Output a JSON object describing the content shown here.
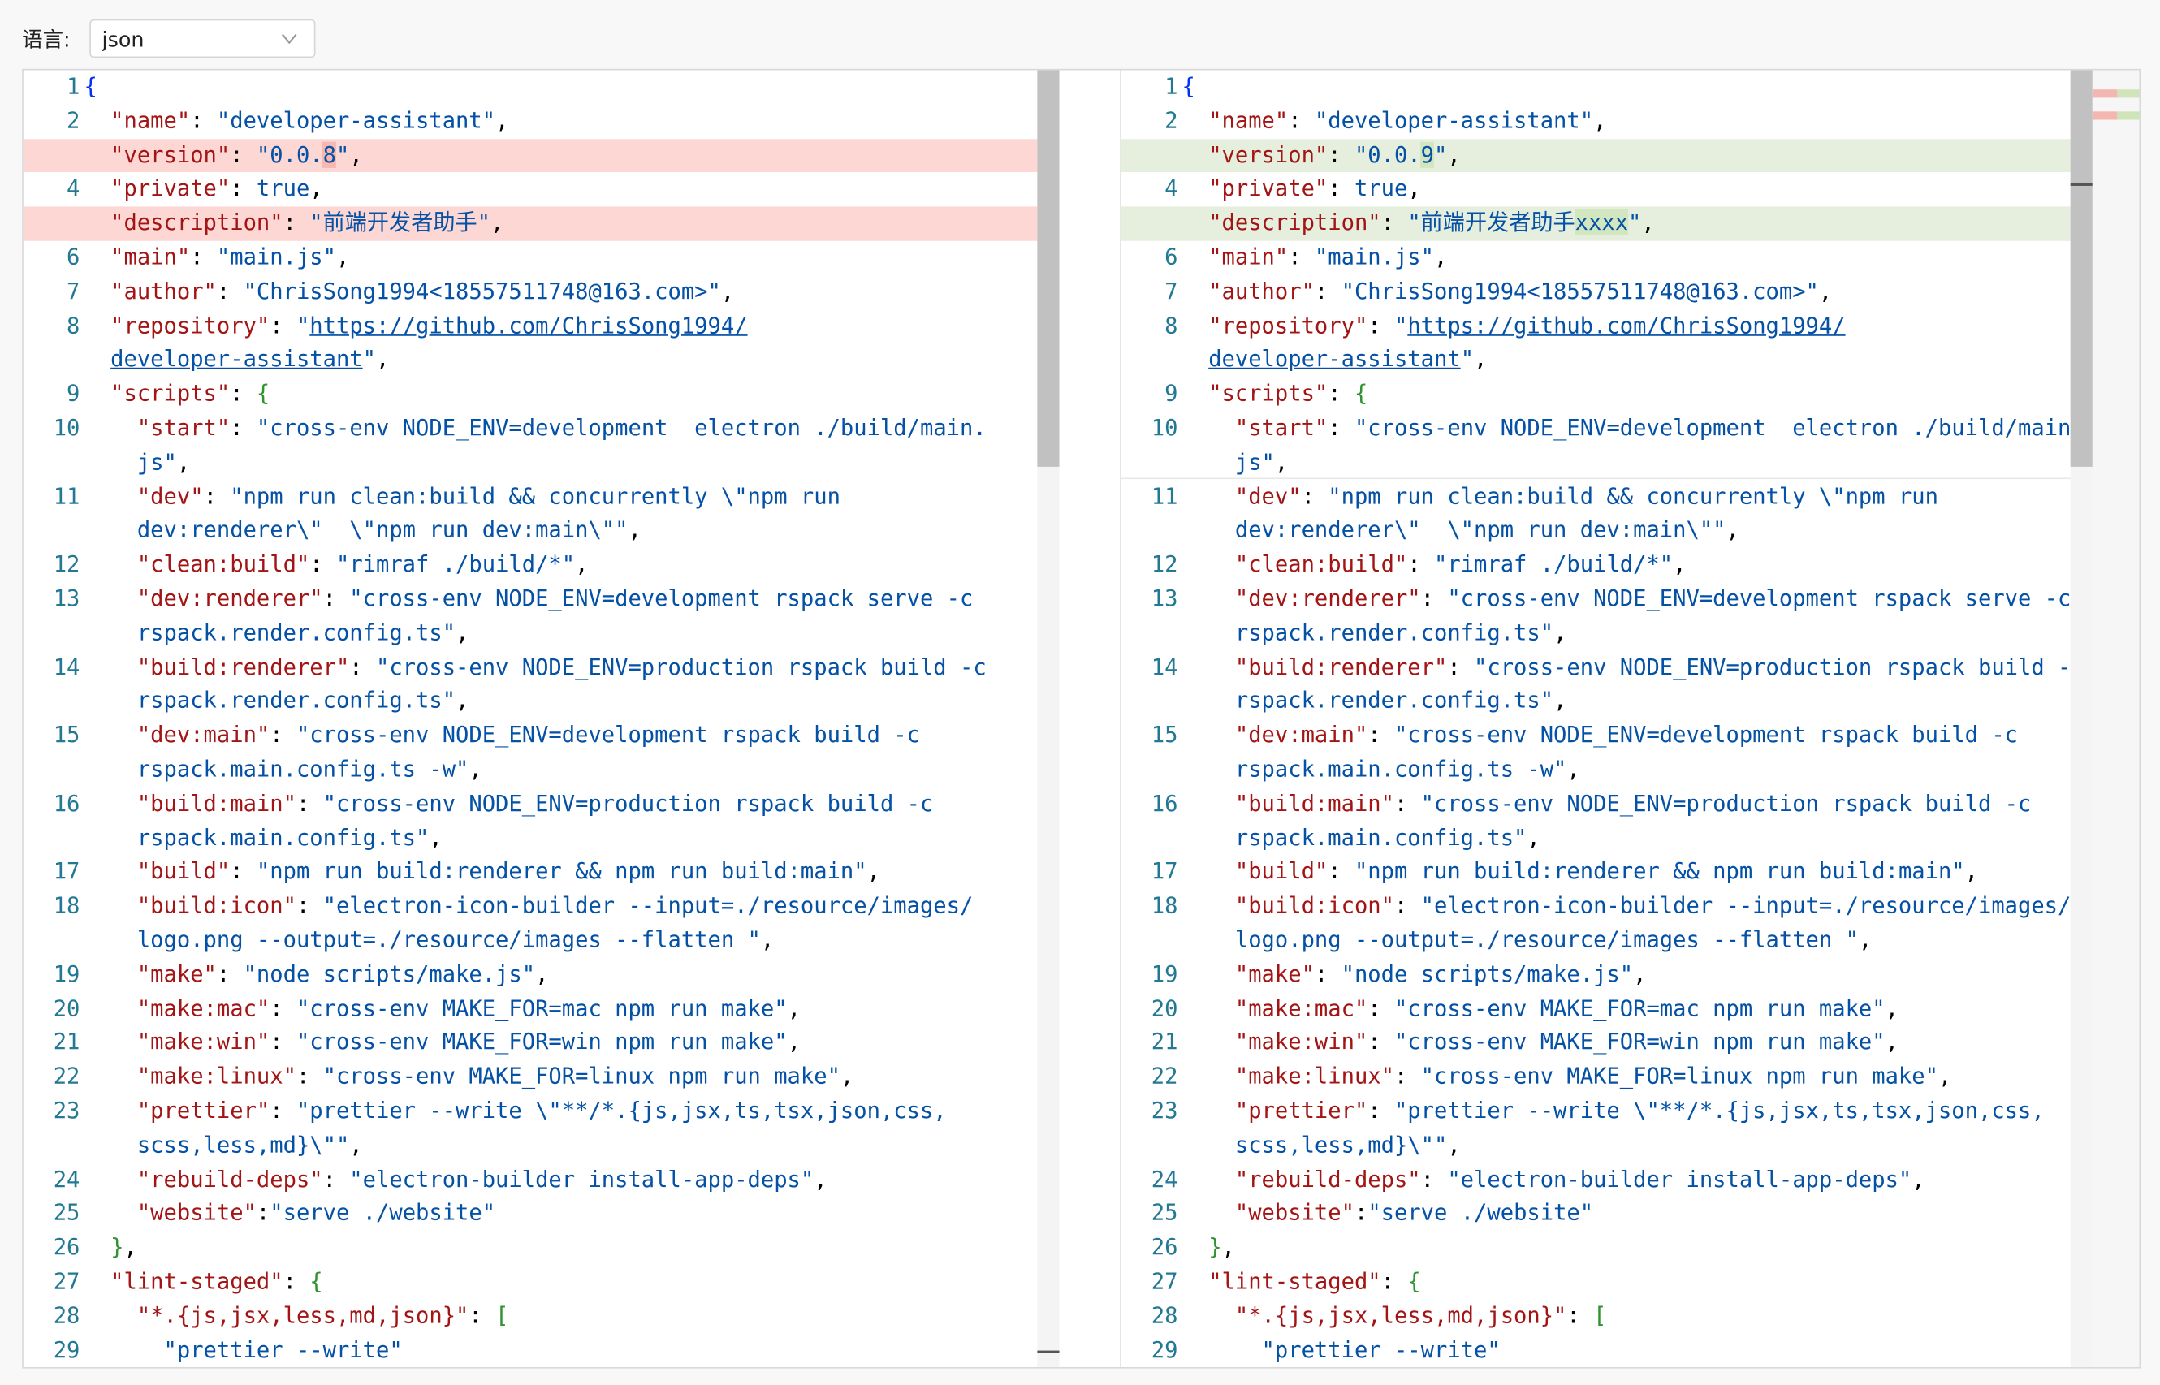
{
  "toolbar": {
    "language_label": "语言:",
    "language_value": "json"
  },
  "overview_colors": {
    "deleted": "#f4b6b0",
    "inserted": "#cfe4b8"
  },
  "left_lines": [
    {
      "n": "1",
      "segs": [
        [
          "b",
          "{"
        ]
      ]
    },
    {
      "n": "2",
      "segs": [
        [
          "k",
          "  \"name\""
        ],
        [
          "p",
          ": "
        ],
        [
          "s",
          "\"developer-assistant\""
        ],
        [
          "p",
          ","
        ]
      ]
    },
    {
      "n": "3",
      "segs": [
        [
          "k",
          "  \"version\""
        ],
        [
          "p",
          ": "
        ],
        [
          "s",
          "\"0.0."
        ],
        [
          "s",
          "8",
          "ch-del"
        ],
        [
          "s",
          "\""
        ],
        [
          "p",
          ","
        ]
      ],
      "hl": "del"
    },
    {
      "n": "4",
      "segs": [
        [
          "k",
          "  \"private\""
        ],
        [
          "p",
          ": "
        ],
        [
          "s",
          "true"
        ],
        [
          "p",
          ","
        ]
      ]
    },
    {
      "n": "5",
      "segs": [
        [
          "k",
          "  \"description\""
        ],
        [
          "p",
          ": "
        ],
        [
          "s",
          "\"前端开发者助手\""
        ],
        [
          "p",
          ","
        ]
      ],
      "hl": "del"
    },
    {
      "n": "6",
      "segs": [
        [
          "k",
          "  \"main\""
        ],
        [
          "p",
          ": "
        ],
        [
          "s",
          "\"main.js\""
        ],
        [
          "p",
          ","
        ]
      ]
    },
    {
      "n": "7",
      "segs": [
        [
          "k",
          "  \"author\""
        ],
        [
          "p",
          ": "
        ],
        [
          "s",
          "\"ChrisSong1994<18557511748@163.com>\""
        ],
        [
          "p",
          ","
        ]
      ]
    },
    {
      "n": "8",
      "segs": [
        [
          "k",
          "  \"repository\""
        ],
        [
          "p",
          ": "
        ],
        [
          "s",
          "\""
        ],
        [
          "s",
          "https://github.com/ChrisSong1994/",
          "u"
        ]
      ]
    },
    {
      "n": "",
      "segs": [
        [
          "s",
          "  "
        ],
        [
          "s",
          "developer-assistant",
          "u"
        ],
        [
          "s",
          "\""
        ],
        [
          "p",
          ","
        ]
      ]
    },
    {
      "n": "9",
      "segs": [
        [
          "k",
          "  \"scripts\""
        ],
        [
          "p",
          ": "
        ],
        [
          "b2",
          "{"
        ]
      ]
    },
    {
      "n": "10",
      "segs": [
        [
          "k",
          "    \"start\""
        ],
        [
          "p",
          ": "
        ],
        [
          "s",
          "\"cross-env NODE_ENV=development  electron ./build/main."
        ]
      ]
    },
    {
      "n": "",
      "segs": [
        [
          "s",
          "    js\""
        ],
        [
          "p",
          ","
        ]
      ]
    },
    {
      "n": "11",
      "segs": [
        [
          "k",
          "    \"dev\""
        ],
        [
          "p",
          ": "
        ],
        [
          "s",
          "\"npm run clean:build && concurrently \\\"npm run"
        ]
      ]
    },
    {
      "n": "",
      "segs": [
        [
          "s",
          "    dev:renderer\\\"  \\\"npm run dev:main\\\"\""
        ],
        [
          "p",
          ","
        ]
      ]
    },
    {
      "n": "12",
      "segs": [
        [
          "k",
          "    \"clean:build\""
        ],
        [
          "p",
          ": "
        ],
        [
          "s",
          "\"rimraf ./build/*\""
        ],
        [
          "p",
          ","
        ]
      ]
    },
    {
      "n": "13",
      "segs": [
        [
          "k",
          "    \"dev:renderer\""
        ],
        [
          "p",
          ": "
        ],
        [
          "s",
          "\"cross-env NODE_ENV=development rspack serve -c"
        ]
      ]
    },
    {
      "n": "",
      "segs": [
        [
          "s",
          "    rspack.render.config.ts\""
        ],
        [
          "p",
          ","
        ]
      ]
    },
    {
      "n": "14",
      "segs": [
        [
          "k",
          "    \"build:renderer\""
        ],
        [
          "p",
          ": "
        ],
        [
          "s",
          "\"cross-env NODE_ENV=production rspack build -c"
        ]
      ]
    },
    {
      "n": "",
      "segs": [
        [
          "s",
          "    rspack.render.config.ts\""
        ],
        [
          "p",
          ","
        ]
      ]
    },
    {
      "n": "15",
      "segs": [
        [
          "k",
          "    \"dev:main\""
        ],
        [
          "p",
          ": "
        ],
        [
          "s",
          "\"cross-env NODE_ENV=development rspack build -c"
        ]
      ]
    },
    {
      "n": "",
      "segs": [
        [
          "s",
          "    rspack.main.config.ts -w\""
        ],
        [
          "p",
          ","
        ]
      ]
    },
    {
      "n": "16",
      "segs": [
        [
          "k",
          "    \"build:main\""
        ],
        [
          "p",
          ": "
        ],
        [
          "s",
          "\"cross-env NODE_ENV=production rspack build -c"
        ]
      ]
    },
    {
      "n": "",
      "segs": [
        [
          "s",
          "    rspack.main.config.ts\""
        ],
        [
          "p",
          ","
        ]
      ]
    },
    {
      "n": "17",
      "segs": [
        [
          "k",
          "    \"build\""
        ],
        [
          "p",
          ": "
        ],
        [
          "s",
          "\"npm run build:renderer && npm run build:main\""
        ],
        [
          "p",
          ","
        ]
      ]
    },
    {
      "n": "18",
      "segs": [
        [
          "k",
          "    \"build:icon\""
        ],
        [
          "p",
          ": "
        ],
        [
          "s",
          "\"electron-icon-builder --input=./resource/images/"
        ]
      ]
    },
    {
      "n": "",
      "segs": [
        [
          "s",
          "    logo.png --output=./resource/images --flatten \""
        ],
        [
          "p",
          ","
        ]
      ]
    },
    {
      "n": "19",
      "segs": [
        [
          "k",
          "    \"make\""
        ],
        [
          "p",
          ": "
        ],
        [
          "s",
          "\"node scripts/make.js\""
        ],
        [
          "p",
          ","
        ]
      ]
    },
    {
      "n": "20",
      "segs": [
        [
          "k",
          "    \"make:mac\""
        ],
        [
          "p",
          ": "
        ],
        [
          "s",
          "\"cross-env MAKE_FOR=mac npm run make\""
        ],
        [
          "p",
          ","
        ]
      ]
    },
    {
      "n": "21",
      "segs": [
        [
          "k",
          "    \"make:win\""
        ],
        [
          "p",
          ": "
        ],
        [
          "s",
          "\"cross-env MAKE_FOR=win npm run make\""
        ],
        [
          "p",
          ","
        ]
      ]
    },
    {
      "n": "22",
      "segs": [
        [
          "k",
          "    \"make:linux\""
        ],
        [
          "p",
          ": "
        ],
        [
          "s",
          "\"cross-env MAKE_FOR=linux npm run make\""
        ],
        [
          "p",
          ","
        ]
      ]
    },
    {
      "n": "23",
      "segs": [
        [
          "k",
          "    \"prettier\""
        ],
        [
          "p",
          ": "
        ],
        [
          "s",
          "\"prettier --write \\\"**/*.{js,jsx,ts,tsx,json,css,"
        ]
      ]
    },
    {
      "n": "",
      "segs": [
        [
          "s",
          "    scss,less,md}\\\"\""
        ],
        [
          "p",
          ","
        ]
      ]
    },
    {
      "n": "24",
      "segs": [
        [
          "k",
          "    \"rebuild-deps\""
        ],
        [
          "p",
          ": "
        ],
        [
          "s",
          "\"electron-builder install-app-deps\""
        ],
        [
          "p",
          ","
        ]
      ]
    },
    {
      "n": "25",
      "segs": [
        [
          "k",
          "    \"website\""
        ],
        [
          "p",
          ":"
        ],
        [
          "s",
          "\"serve ./website\""
        ]
      ]
    },
    {
      "n": "26",
      "segs": [
        [
          "b2",
          "  }"
        ],
        [
          "p",
          ","
        ]
      ]
    },
    {
      "n": "27",
      "segs": [
        [
          "k",
          "  \"lint-staged\""
        ],
        [
          "p",
          ": "
        ],
        [
          "b2",
          "{"
        ]
      ]
    },
    {
      "n": "28",
      "segs": [
        [
          "k",
          "    \"*.{js,jsx,less,md,json}\""
        ],
        [
          "p",
          ": "
        ],
        [
          "b2",
          "["
        ]
      ]
    },
    {
      "n": "29",
      "segs": [
        [
          "s",
          "      \"prettier --write\""
        ]
      ]
    }
  ],
  "right_lines": [
    {
      "n": "1",
      "segs": [
        [
          "b",
          "{"
        ]
      ]
    },
    {
      "n": "2",
      "segs": [
        [
          "k",
          "  \"name\""
        ],
        [
          "p",
          ": "
        ],
        [
          "s",
          "\"developer-assistant\""
        ],
        [
          "p",
          ","
        ]
      ]
    },
    {
      "n": "3",
      "segs": [
        [
          "k",
          "  \"version\""
        ],
        [
          "p",
          ": "
        ],
        [
          "s",
          "\"0.0."
        ],
        [
          "s",
          "9",
          "ch-add"
        ],
        [
          "s",
          "\""
        ],
        [
          "p",
          ","
        ]
      ],
      "hl": "add"
    },
    {
      "n": "4",
      "segs": [
        [
          "k",
          "  \"private\""
        ],
        [
          "p",
          ": "
        ],
        [
          "s",
          "true"
        ],
        [
          "p",
          ","
        ]
      ]
    },
    {
      "n": "5",
      "segs": [
        [
          "k",
          "  \"description\""
        ],
        [
          "p",
          ": "
        ],
        [
          "s",
          "\"前端开发者助手"
        ],
        [
          "s",
          "xxxx",
          "ch-add"
        ],
        [
          "s",
          "\""
        ],
        [
          "p",
          ","
        ]
      ],
      "hl": "add"
    },
    {
      "n": "6",
      "segs": [
        [
          "k",
          "  \"main\""
        ],
        [
          "p",
          ": "
        ],
        [
          "s",
          "\"main.js\""
        ],
        [
          "p",
          ","
        ]
      ]
    },
    {
      "n": "7",
      "segs": [
        [
          "k",
          "  \"author\""
        ],
        [
          "p",
          ": "
        ],
        [
          "s",
          "\"ChrisSong1994<18557511748@163.com>\""
        ],
        [
          "p",
          ","
        ]
      ]
    },
    {
      "n": "8",
      "segs": [
        [
          "k",
          "  \"repository\""
        ],
        [
          "p",
          ": "
        ],
        [
          "s",
          "\""
        ],
        [
          "s",
          "https://github.com/ChrisSong1994/",
          "u"
        ]
      ]
    },
    {
      "n": "",
      "segs": [
        [
          "s",
          "  "
        ],
        [
          "s",
          "developer-assistant",
          "u"
        ],
        [
          "s",
          "\""
        ],
        [
          "p",
          ","
        ]
      ]
    },
    {
      "n": "9",
      "segs": [
        [
          "k",
          "  \"scripts\""
        ],
        [
          "p",
          ": "
        ],
        [
          "b2",
          "{"
        ]
      ]
    },
    {
      "n": "10",
      "segs": [
        [
          "k",
          "    \"start\""
        ],
        [
          "p",
          ": "
        ],
        [
          "s",
          "\"cross-env NODE_ENV=development  electron ./build/main."
        ]
      ]
    },
    {
      "n": "",
      "segs": [
        [
          "s",
          "    js\""
        ],
        [
          "p",
          ","
        ]
      ]
    },
    {
      "n": "11",
      "segs": [
        [
          "k",
          "    \"dev\""
        ],
        [
          "p",
          ": "
        ],
        [
          "s",
          "\"npm run clean:build && concurrently \\\"npm run"
        ]
      ]
    },
    {
      "n": "",
      "segs": [
        [
          "s",
          "    dev:renderer\\\"  \\\"npm run dev:main\\\"\""
        ],
        [
          "p",
          ","
        ]
      ]
    },
    {
      "n": "12",
      "segs": [
        [
          "k",
          "    \"clean:build\""
        ],
        [
          "p",
          ": "
        ],
        [
          "s",
          "\"rimraf ./build/*\""
        ],
        [
          "p",
          ","
        ]
      ]
    },
    {
      "n": "13",
      "segs": [
        [
          "k",
          "    \"dev:renderer\""
        ],
        [
          "p",
          ": "
        ],
        [
          "s",
          "\"cross-env NODE_ENV=development rspack serve -c"
        ]
      ]
    },
    {
      "n": "",
      "segs": [
        [
          "s",
          "    rspack.render.config.ts\""
        ],
        [
          "p",
          ","
        ]
      ]
    },
    {
      "n": "14",
      "segs": [
        [
          "k",
          "    \"build:renderer\""
        ],
        [
          "p",
          ": "
        ],
        [
          "s",
          "\"cross-env NODE_ENV=production rspack build -c"
        ]
      ]
    },
    {
      "n": "",
      "segs": [
        [
          "s",
          "    rspack.render.config.ts\""
        ],
        [
          "p",
          ","
        ]
      ]
    },
    {
      "n": "15",
      "segs": [
        [
          "k",
          "    \"dev:main\""
        ],
        [
          "p",
          ": "
        ],
        [
          "s",
          "\"cross-env NODE_ENV=development rspack build -c"
        ]
      ]
    },
    {
      "n": "",
      "segs": [
        [
          "s",
          "    rspack.main.config.ts -w\""
        ],
        [
          "p",
          ","
        ]
      ]
    },
    {
      "n": "16",
      "segs": [
        [
          "k",
          "    \"build:main\""
        ],
        [
          "p",
          ": "
        ],
        [
          "s",
          "\"cross-env NODE_ENV=production rspack build -c"
        ]
      ]
    },
    {
      "n": "",
      "segs": [
        [
          "s",
          "    rspack.main.config.ts\""
        ],
        [
          "p",
          ","
        ]
      ]
    },
    {
      "n": "17",
      "segs": [
        [
          "k",
          "    \"build\""
        ],
        [
          "p",
          ": "
        ],
        [
          "s",
          "\"npm run build:renderer && npm run build:main\""
        ],
        [
          "p",
          ","
        ]
      ]
    },
    {
      "n": "18",
      "segs": [
        [
          "k",
          "    \"build:icon\""
        ],
        [
          "p",
          ": "
        ],
        [
          "s",
          "\"electron-icon-builder --input=./resource/images/"
        ]
      ]
    },
    {
      "n": "",
      "segs": [
        [
          "s",
          "    logo.png --output=./resource/images --flatten \""
        ],
        [
          "p",
          ","
        ]
      ]
    },
    {
      "n": "19",
      "segs": [
        [
          "k",
          "    \"make\""
        ],
        [
          "p",
          ": "
        ],
        [
          "s",
          "\"node scripts/make.js\""
        ],
        [
          "p",
          ","
        ]
      ]
    },
    {
      "n": "20",
      "segs": [
        [
          "k",
          "    \"make:mac\""
        ],
        [
          "p",
          ": "
        ],
        [
          "s",
          "\"cross-env MAKE_FOR=mac npm run make\""
        ],
        [
          "p",
          ","
        ]
      ]
    },
    {
      "n": "21",
      "segs": [
        [
          "k",
          "    \"make:win\""
        ],
        [
          "p",
          ": "
        ],
        [
          "s",
          "\"cross-env MAKE_FOR=win npm run make\""
        ],
        [
          "p",
          ","
        ]
      ]
    },
    {
      "n": "22",
      "segs": [
        [
          "k",
          "    \"make:linux\""
        ],
        [
          "p",
          ": "
        ],
        [
          "s",
          "\"cross-env MAKE_FOR=linux npm run make\""
        ],
        [
          "p",
          ","
        ]
      ]
    },
    {
      "n": "23",
      "segs": [
        [
          "k",
          "    \"prettier\""
        ],
        [
          "p",
          ": "
        ],
        [
          "s",
          "\"prettier --write \\\"**/*.{js,jsx,ts,tsx,json,css,"
        ]
      ]
    },
    {
      "n": "",
      "segs": [
        [
          "s",
          "    scss,less,md}\\\"\""
        ],
        [
          "p",
          ","
        ]
      ]
    },
    {
      "n": "24",
      "segs": [
        [
          "k",
          "    \"rebuild-deps\""
        ],
        [
          "p",
          ": "
        ],
        [
          "s",
          "\"electron-builder install-app-deps\""
        ],
        [
          "p",
          ","
        ]
      ]
    },
    {
      "n": "25",
      "segs": [
        [
          "k",
          "    \"website\""
        ],
        [
          "p",
          ":"
        ],
        [
          "s",
          "\"serve ./website\""
        ]
      ]
    },
    {
      "n": "26",
      "segs": [
        [
          "b2",
          "  }"
        ],
        [
          "p",
          ","
        ]
      ]
    },
    {
      "n": "27",
      "segs": [
        [
          "k",
          "  \"lint-staged\""
        ],
        [
          "p",
          ": "
        ],
        [
          "b2",
          "{"
        ]
      ]
    },
    {
      "n": "28",
      "segs": [
        [
          "k",
          "    \"*.{js,jsx,less,md,json}\""
        ],
        [
          "p",
          ": "
        ],
        [
          "b2",
          "["
        ]
      ]
    },
    {
      "n": "29",
      "segs": [
        [
          "s",
          "      \"prettier --write\""
        ]
      ]
    }
  ]
}
